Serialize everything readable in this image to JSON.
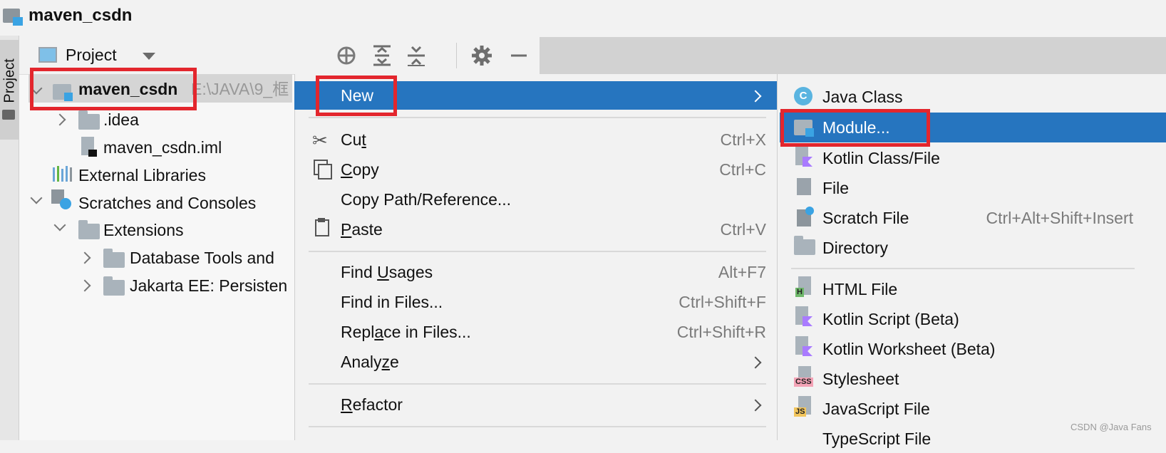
{
  "window": {
    "title": "maven_csdn"
  },
  "left_stripe": {
    "label": "Project"
  },
  "project_panel": {
    "title": "Project"
  },
  "tree": {
    "root": {
      "name": "maven_csdn",
      "path": "E:\\JAVA\\9_框"
    },
    "idea": ".idea",
    "iml": "maven_csdn.iml",
    "external": "External Libraries",
    "scratches": "Scratches and Consoles",
    "extensions": "Extensions",
    "db_tools": "Database Tools and",
    "jakarta": "Jakarta EE: Persisten"
  },
  "context_menu": {
    "new": "New",
    "cut": {
      "pre": "Cu",
      "u": "t",
      "post": "",
      "shortcut": "Ctrl+X"
    },
    "copy": {
      "pre": "",
      "u": "C",
      "post": "opy",
      "shortcut": "Ctrl+C"
    },
    "copy_path": "Copy Path/Reference...",
    "paste": {
      "pre": "",
      "u": "P",
      "post": "aste",
      "shortcut": "Ctrl+V"
    },
    "find_usages": {
      "pre": "Find ",
      "u": "U",
      "post": "sages",
      "shortcut": "Alt+F7"
    },
    "find_in_files": {
      "label": "Find in Files...",
      "shortcut": "Ctrl+Shift+F"
    },
    "replace_in_files": {
      "pre": "Repl",
      "u": "a",
      "post": "ce in Files...",
      "shortcut": "Ctrl+Shift+R"
    },
    "analyze": {
      "pre": "Analy",
      "u": "z",
      "post": "e"
    },
    "refactor": {
      "pre": "",
      "u": "R",
      "post": "efactor"
    }
  },
  "new_submenu": {
    "java_class": "Java Class",
    "module": "Module...",
    "kotlin_class": "Kotlin Class/File",
    "file": "File",
    "scratch_file": {
      "label": "Scratch File",
      "shortcut": "Ctrl+Alt+Shift+Insert"
    },
    "directory": "Directory",
    "html_file": "HTML File",
    "kotlin_script": "Kotlin Script (Beta)",
    "kotlin_worksheet": "Kotlin Worksheet (Beta)",
    "stylesheet": "Stylesheet",
    "javascript_file": "JavaScript File",
    "typescript_file": "TypeScript File"
  },
  "icons": {
    "java_class_letter": "C",
    "html_badge": "H",
    "css_badge": "CSS",
    "js_badge": "JS"
  },
  "colors": {
    "selection": "#2675bf",
    "highlight_box": "#e3262d"
  },
  "watermark": "CSDN @Java Fans"
}
